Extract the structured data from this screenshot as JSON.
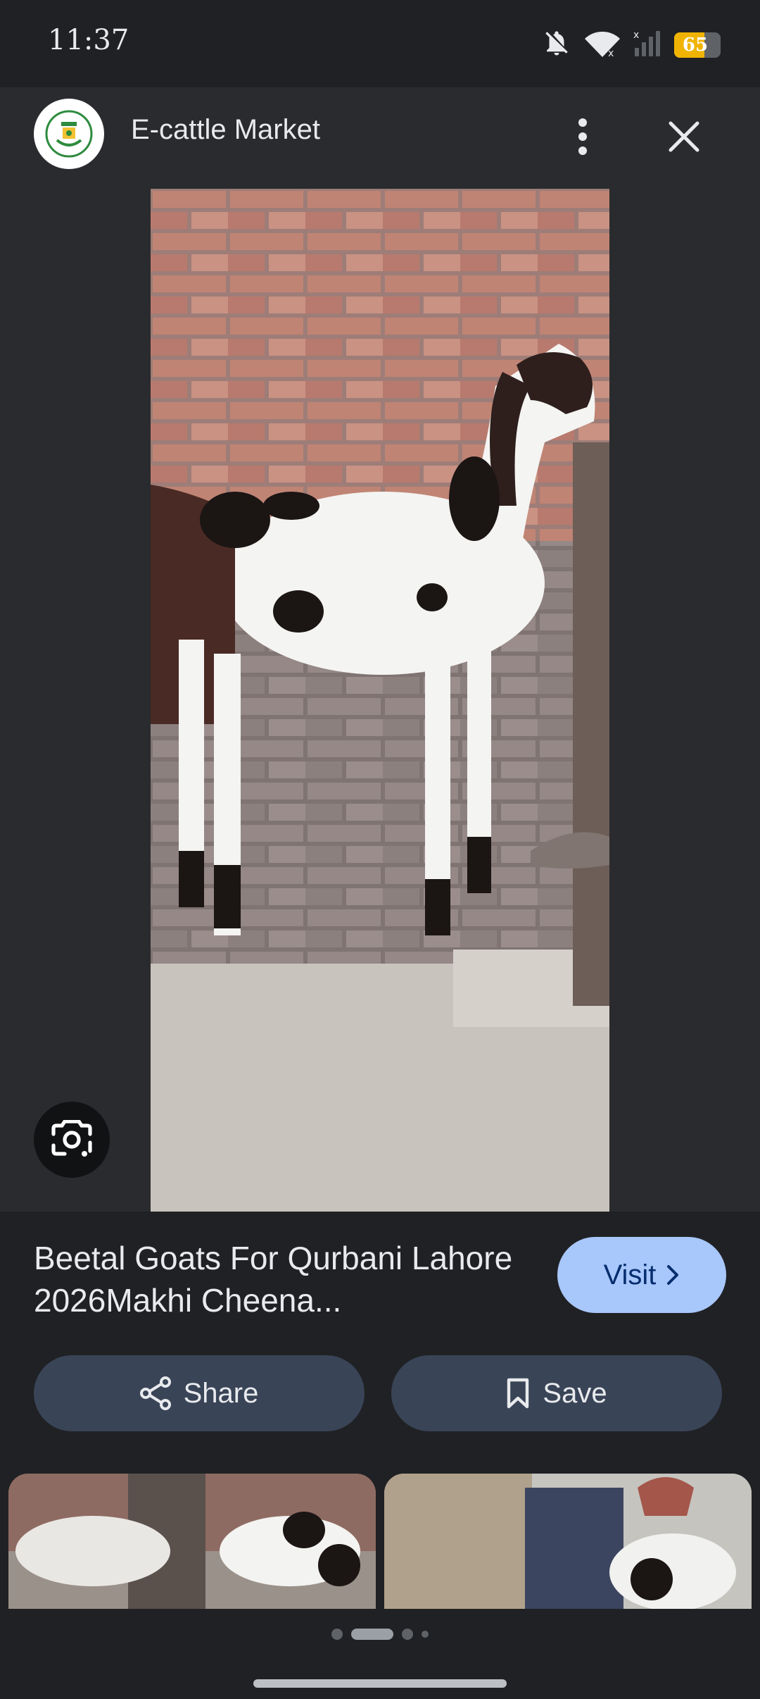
{
  "status_bar": {
    "time": "11:37",
    "battery_level": "65",
    "battery_fraction": 0.65,
    "icons": [
      "bell-off-icon",
      "wifi-icon",
      "signal-icon",
      "battery-icon"
    ]
  },
  "header": {
    "site_name": "E-cattle Market",
    "logo_icon": "punjab-govt-logo-icon",
    "more_icon": "more-vert-icon",
    "close_icon": "close-icon"
  },
  "image_viewer": {
    "lens_icon": "google-lens-icon"
  },
  "result": {
    "title": "Beetal Goats For Qurbani Lahore 2026Makhi Cheena...",
    "visit_label": "Visit"
  },
  "actions": {
    "share_label": "Share",
    "save_label": "Save"
  },
  "pagination": {
    "active_index": 1,
    "count": 4
  },
  "colors": {
    "background": "#202124",
    "panel": "#2a2b2e",
    "visit_button": "#a8c7fa",
    "action_button": "#394457",
    "battery": "#f0b400"
  }
}
